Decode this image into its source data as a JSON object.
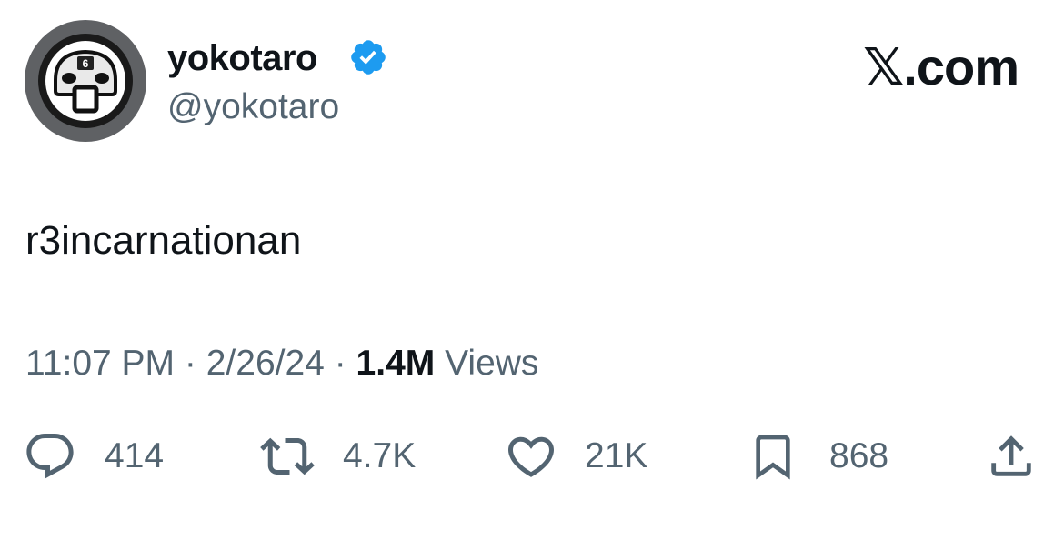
{
  "author": {
    "display_name": "yokotaro",
    "handle": "@yokotaro",
    "verified": true,
    "avatar_badge": "6"
  },
  "brand": "𝕏.com",
  "tweet": {
    "text": "r3incarnationan"
  },
  "meta": {
    "time": "11:07 PM",
    "separator1": "·",
    "date": "2/26/24",
    "separator2": "·",
    "views_count": "1.4M",
    "views_label": "Views"
  },
  "actions": {
    "replies": "414",
    "reposts": "4.7K",
    "likes": "21K",
    "bookmarks": "868"
  },
  "colors": {
    "text_primary": "#0f1419",
    "text_secondary": "#536471",
    "verified_blue": "#1d9bf0",
    "avatar_bg": "#5f6164"
  },
  "icons": [
    "verified-badge-icon",
    "reply-icon",
    "repost-icon",
    "like-icon",
    "bookmark-icon",
    "share-icon"
  ]
}
